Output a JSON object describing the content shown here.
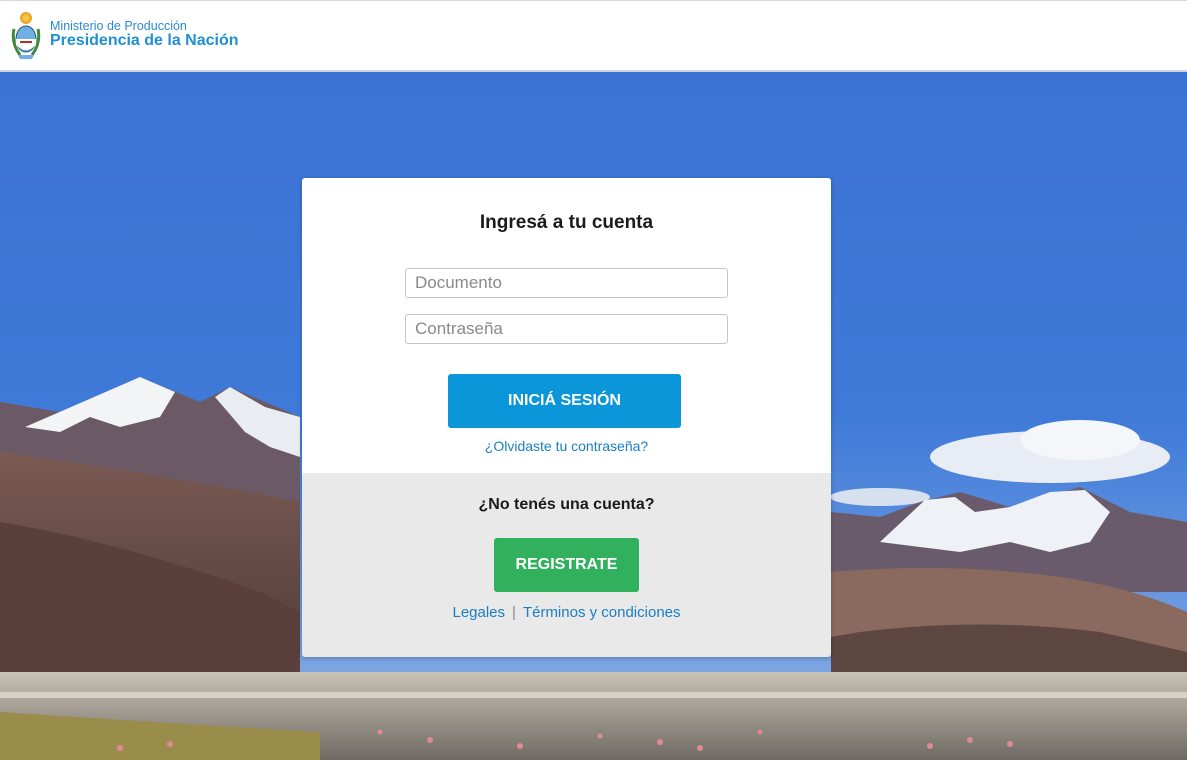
{
  "header": {
    "ministry": "Ministerio de Producción",
    "presidency": "Presidencia de la Nación"
  },
  "login": {
    "title": "Ingresá a tu cuenta",
    "document_placeholder": "Documento",
    "password_placeholder": "Contraseña",
    "login_button": "INICIÁ SESIÓN",
    "forgot_link": "¿Olvidaste tu contraseña?"
  },
  "register": {
    "prompt": "¿No tenés una cuenta?",
    "register_button": "REGISTRATE"
  },
  "footer_links": {
    "legal": "Legales",
    "separator": "|",
    "terms": "Términos y condiciones"
  },
  "colors": {
    "brand_blue": "#1f8fd6",
    "login_button": "#0a96d8",
    "register_button": "#31b15e",
    "link": "#1a7fc0"
  },
  "icons": {
    "logo": "argentina-coat-of-arms-icon"
  }
}
